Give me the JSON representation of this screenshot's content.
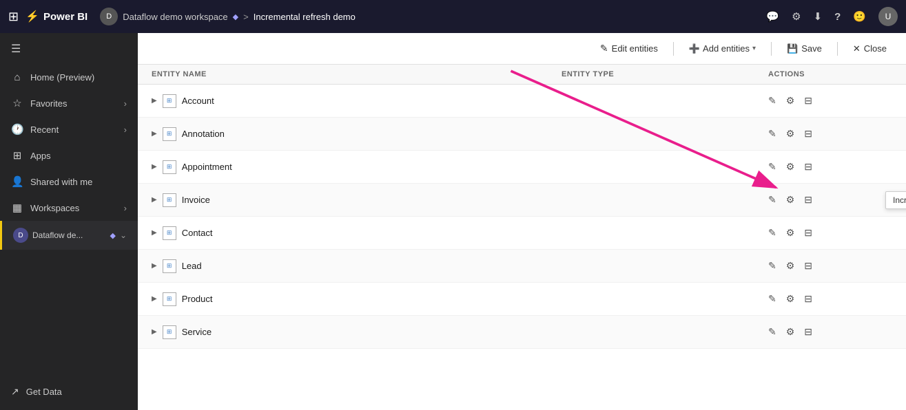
{
  "topbar": {
    "waffle_label": "⊞",
    "app_name": "Power BI",
    "workspace_icon_label": "D",
    "workspace_name": "Dataflow demo workspace",
    "diamond": "◆",
    "separator": ">",
    "current_page": "Incremental refresh demo",
    "icons": {
      "chat": "💬",
      "settings": "⚙",
      "download": "⬇",
      "help": "?",
      "user_smile": "🙂"
    },
    "avatar_label": "U"
  },
  "sidebar": {
    "toggle_icon": "☰",
    "items": [
      {
        "id": "home",
        "icon": "⌂",
        "label": "Home (Preview)",
        "chevron": ""
      },
      {
        "id": "favorites",
        "icon": "☆",
        "label": "Favorites",
        "chevron": "›"
      },
      {
        "id": "recent",
        "icon": "🕐",
        "label": "Recent",
        "chevron": "›"
      },
      {
        "id": "apps",
        "icon": "⊞",
        "label": "Apps",
        "chevron": ""
      },
      {
        "id": "shared",
        "icon": "👤",
        "label": "Shared with me",
        "chevron": ""
      },
      {
        "id": "workspaces",
        "icon": "⬜",
        "label": "Workspaces",
        "chevron": "›"
      }
    ],
    "dataflow_item": {
      "icon_label": "D",
      "label": "Dataflow de...",
      "diamond": "◆",
      "chevron": "⌄"
    },
    "bottom": {
      "icon": "↗",
      "label": "Get Data"
    }
  },
  "toolbar": {
    "edit_entities_icon": "✎",
    "edit_entities_label": "Edit entities",
    "add_entities_icon": "➕",
    "add_entities_label": "Add entities",
    "add_entities_chevron": "▾",
    "save_icon": "💾",
    "save_label": "Save",
    "close_icon": "✕",
    "close_label": "Close"
  },
  "table": {
    "columns": {
      "entity_name": "ENTITY NAME",
      "entity_type": "ENTITY TYPE",
      "actions": "ACTIONS"
    },
    "rows": [
      {
        "id": "account",
        "name": "Account",
        "type": "",
        "tooltip": false
      },
      {
        "id": "annotation",
        "name": "Annotation",
        "type": "",
        "tooltip": false
      },
      {
        "id": "appointment",
        "name": "Appointment",
        "type": "",
        "tooltip": false
      },
      {
        "id": "invoice",
        "name": "Invoice",
        "type": "",
        "tooltip": true,
        "tooltip_text": "Incremental Refresh"
      },
      {
        "id": "contact",
        "name": "Contact",
        "type": "",
        "tooltip": false
      },
      {
        "id": "lead",
        "name": "Lead",
        "type": "",
        "tooltip": false
      },
      {
        "id": "product",
        "name": "Product",
        "type": "",
        "tooltip": false
      },
      {
        "id": "service",
        "name": "Service",
        "type": "",
        "tooltip": false
      }
    ]
  },
  "colors": {
    "topbar_bg": "#1a1a2e",
    "sidebar_bg": "#252526",
    "accent_yellow": "#f2c811",
    "arrow_color": "#e91e8c",
    "active_border": "#f2c811"
  }
}
